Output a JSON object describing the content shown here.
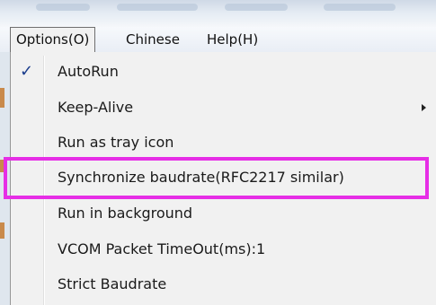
{
  "menubar": {
    "items": [
      {
        "label": "Options(O)",
        "active": true
      },
      {
        "label": "Chinese",
        "active": false
      },
      {
        "label": "Help(H)",
        "active": false
      }
    ]
  },
  "options_menu": {
    "items": [
      {
        "label": "AutoRun",
        "checked": true,
        "check_glyph": "✓",
        "submenu": false
      },
      {
        "label": "Keep-Alive",
        "checked": false,
        "submenu": true
      },
      {
        "label": "Run as tray icon",
        "checked": false,
        "submenu": false
      },
      {
        "label": "Synchronize baudrate(RFC2217 similar)",
        "checked": false,
        "submenu": false,
        "highlighted": true
      },
      {
        "label": "Run in background",
        "checked": false,
        "submenu": false
      },
      {
        "label": "VCOM Packet TimeOut(ms):1",
        "checked": false,
        "submenu": false
      },
      {
        "label": "Strict Baudrate",
        "checked": false,
        "submenu": false
      }
    ]
  },
  "colors": {
    "highlight_border": "#e62ee6",
    "check_mark": "#1a3c8c",
    "menu_background": "#f1f1f1"
  }
}
